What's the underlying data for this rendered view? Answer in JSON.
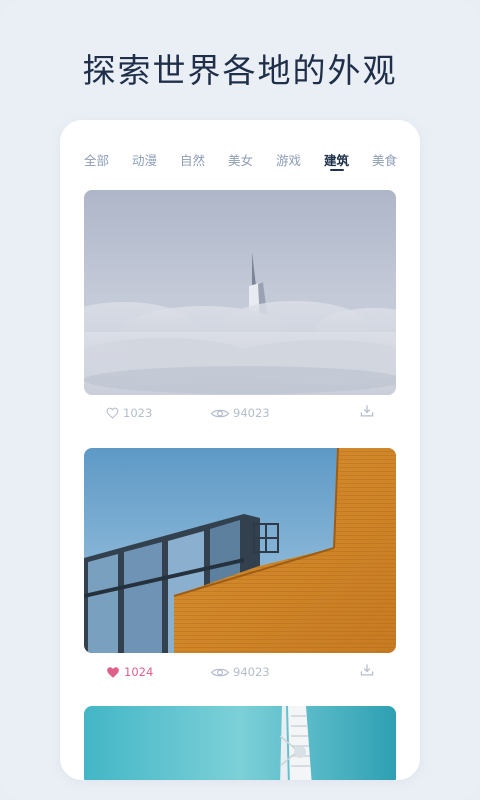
{
  "headline": "探索世界各地的外观",
  "tabs": [
    {
      "label": "全部"
    },
    {
      "label": "动漫"
    },
    {
      "label": "自然"
    },
    {
      "label": "美女"
    },
    {
      "label": "游戏"
    },
    {
      "label": "建筑",
      "active": true
    },
    {
      "label": "美食"
    }
  ],
  "cards": [
    {
      "likes": "1023",
      "liked": false,
      "views": "94023",
      "image": "skyscraper-above-clouds"
    },
    {
      "likes": "1024",
      "liked": true,
      "views": "94023",
      "image": "glass-and-orange-building"
    },
    {
      "image": "sail-shaped-tower"
    }
  ],
  "colors": {
    "accent_like": "#e0608d",
    "text_muted": "#b4bdcb",
    "tab_active": "#22344d"
  }
}
